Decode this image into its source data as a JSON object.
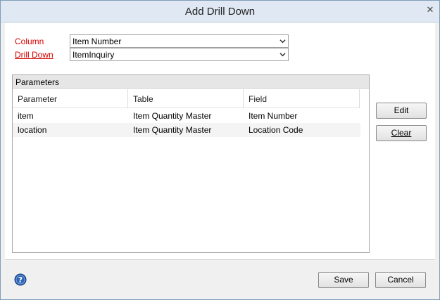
{
  "window": {
    "title": "Add Drill Down"
  },
  "form": {
    "column_label": "Column",
    "column_value": "Item Number",
    "drilldown_label": "Drill Down",
    "drilldown_value": "ItemInquiry"
  },
  "parameters": {
    "group_title": "Parameters",
    "columns": [
      "Parameter",
      "Table",
      "Field"
    ],
    "rows": [
      {
        "parameter": "item",
        "table": "Item Quantity Master",
        "field": "Item Number"
      },
      {
        "parameter": "location",
        "table": "Item Quantity Master",
        "field": "Location Code"
      }
    ]
  },
  "side_buttons": {
    "edit": "Edit",
    "clear": "Clear"
  },
  "footer": {
    "save": "Save",
    "cancel": "Cancel"
  },
  "colors": {
    "required_label": "#d40000",
    "titlebar": "#dfe8f3",
    "help_icon": "#2a63b8"
  },
  "icons": {
    "help": "question-circle-icon",
    "dropdown": "chevron-down-icon",
    "close": "close-icon"
  }
}
